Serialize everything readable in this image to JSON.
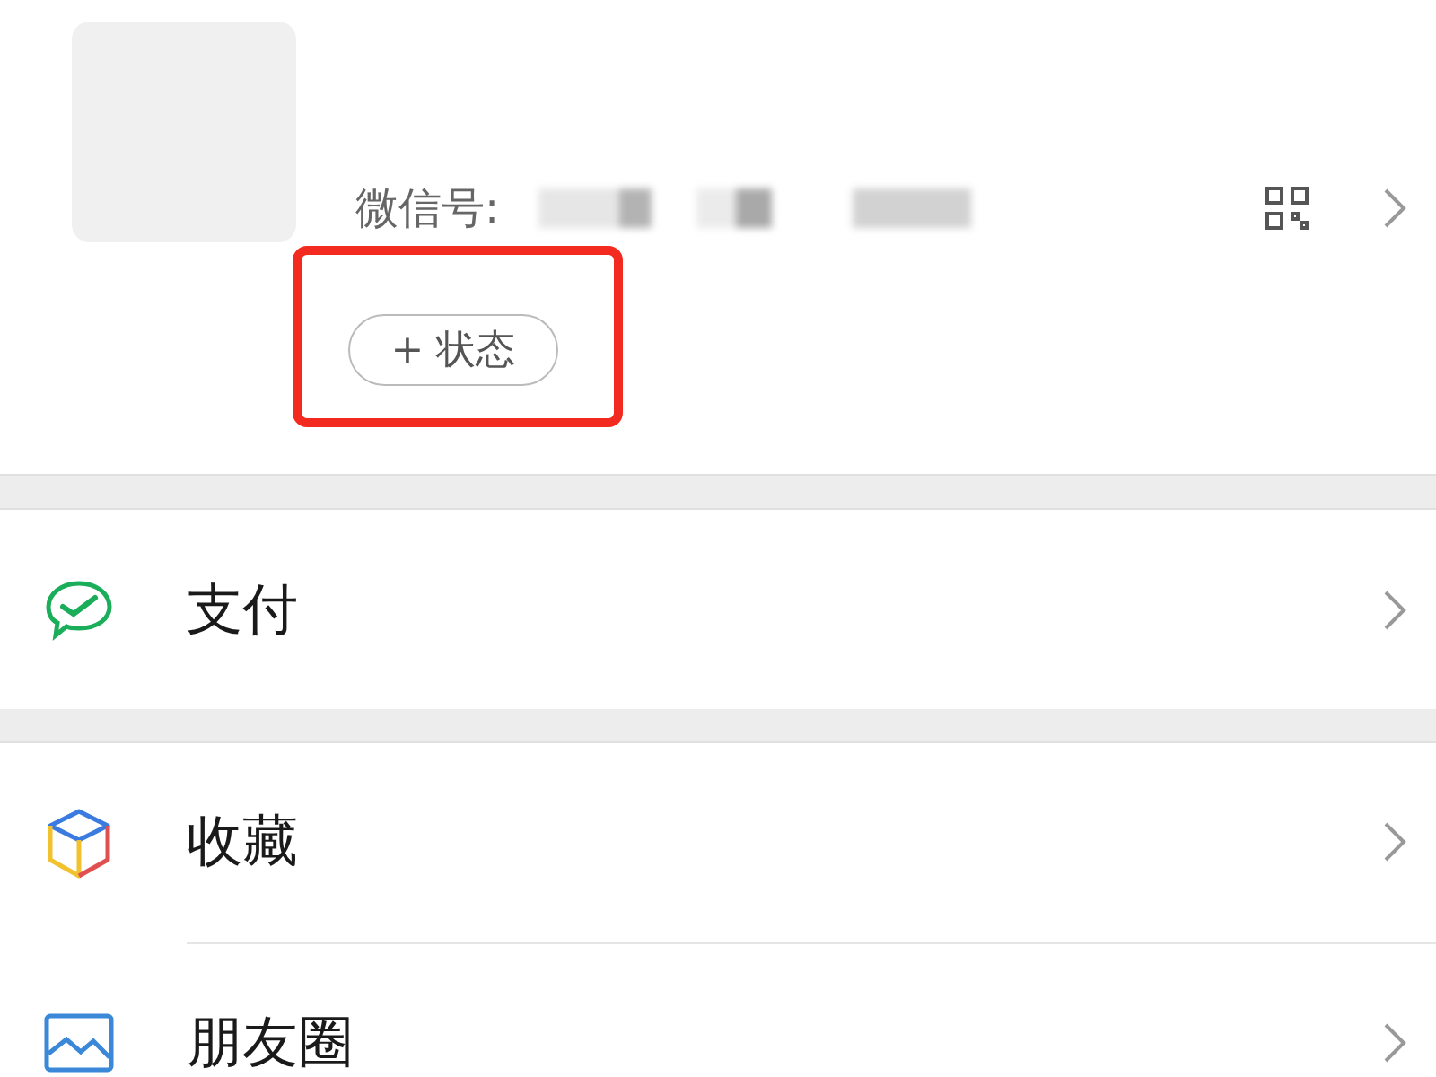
{
  "profile": {
    "id_label": "微信号:",
    "status_button": {
      "label": "+ 状态",
      "highlighted": true
    }
  },
  "sections": [
    {
      "items": [
        {
          "kind": "pay",
          "label": "支付"
        }
      ]
    },
    {
      "items": [
        {
          "kind": "favorites",
          "label": "收藏"
        },
        {
          "kind": "moments",
          "label": "朋友圈"
        }
      ]
    }
  ]
}
